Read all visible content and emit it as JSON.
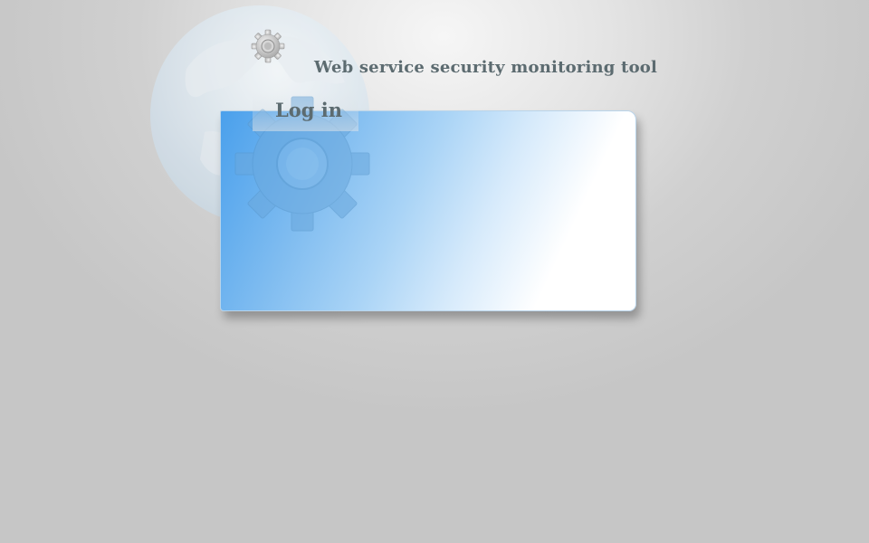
{
  "header": {
    "app_title": "Web service security monitoring tool",
    "logo_icon": "globe-icon",
    "gear_icon": "gear-icon"
  },
  "login": {
    "tab_label": "Log in",
    "panel_icon": "gear-icon"
  },
  "colors": {
    "title_text": "#5c6b70",
    "panel_blue": "#4aa0ec",
    "panel_white": "#ffffff",
    "background": "#d0d0d0"
  }
}
